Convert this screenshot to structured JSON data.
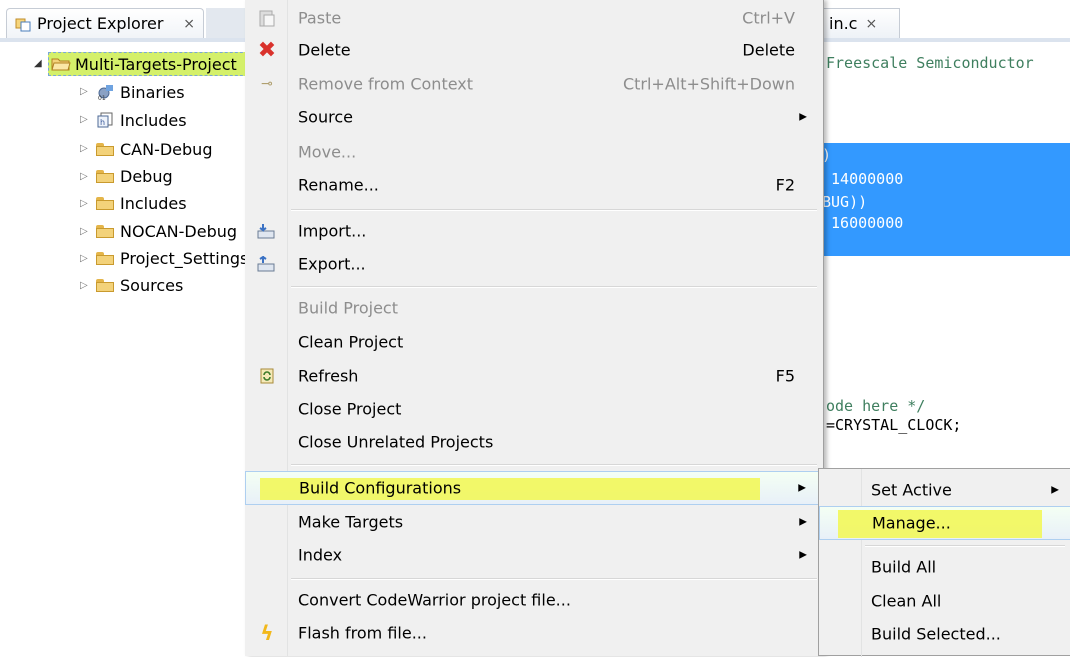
{
  "explorer": {
    "tab_label": "Project Explorer",
    "tab_close": "⨯",
    "root": "Multi-Targets-Project",
    "items": [
      {
        "label": "Binaries",
        "icon": "binaries-icon"
      },
      {
        "label": "Includes",
        "icon": "includes-icon"
      },
      {
        "label": "CAN-Debug",
        "icon": "folder-icon"
      },
      {
        "label": "Debug",
        "icon": "folder-icon"
      },
      {
        "label": "Includes",
        "icon": "folder-icon"
      },
      {
        "label": "NOCAN-Debug",
        "icon": "folder-icon"
      },
      {
        "label": "Project_Settings",
        "icon": "folder-icon"
      },
      {
        "label": "Sources",
        "icon": "folder-icon"
      }
    ]
  },
  "editor": {
    "tab_label": "in.c",
    "tab_close": "⨯",
    "code": {
      "line1": "Freescale Semiconductor",
      "line2": ")",
      "line3": " 14000000",
      "line4": "BUG))",
      "line5": " 16000000",
      "line6": "ode here */",
      "line7": "=CRYSTAL_CLOCK;"
    }
  },
  "menu": {
    "paste": {
      "label": "Paste",
      "accel": "Ctrl+V"
    },
    "delete": {
      "label": "Delete",
      "accel": "Delete"
    },
    "remove": {
      "label": "Remove from Context",
      "accel": "Ctrl+Alt+Shift+Down"
    },
    "source": {
      "label": "Source"
    },
    "move": {
      "label": "Move..."
    },
    "rename": {
      "label": "Rename...",
      "accel": "F2"
    },
    "import": {
      "label": "Import..."
    },
    "export": {
      "label": "Export..."
    },
    "build_project": {
      "label": "Build Project"
    },
    "clean_project": {
      "label": "Clean Project"
    },
    "refresh": {
      "label": "Refresh",
      "accel": "F5"
    },
    "close_project": {
      "label": "Close Project"
    },
    "close_unrelated": {
      "label": "Close Unrelated Projects"
    },
    "build_configurations": {
      "label": "Build Configurations"
    },
    "make_targets": {
      "label": "Make Targets"
    },
    "index": {
      "label": "Index"
    },
    "convert": {
      "label": "Convert CodeWarrior project file..."
    },
    "flash": {
      "label": "Flash from file..."
    }
  },
  "submenu": {
    "set_active": "Set Active",
    "manage": "Manage...",
    "build_all": "Build All",
    "clean_all": "Clean All",
    "build_selected": "Build Selected..."
  },
  "colors": {
    "highlight_yellow": "#f2f75a",
    "selection_blue": "#3399ff",
    "root_highlight": "#d4f06a",
    "code_green": "#3f7f5f"
  }
}
